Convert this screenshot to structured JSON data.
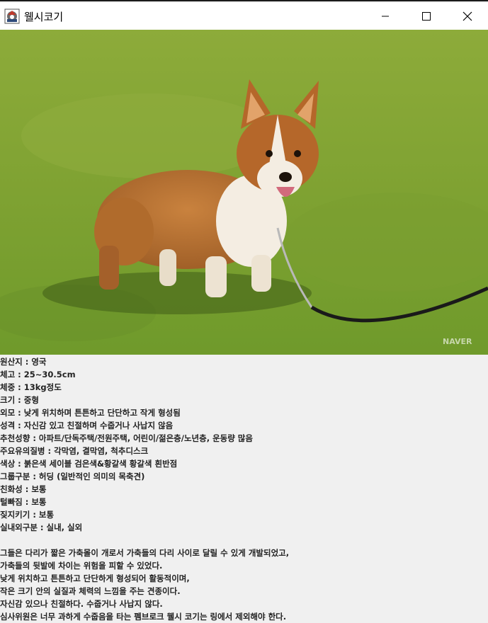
{
  "window": {
    "title": "웰시코기",
    "icon": "app-window-icon",
    "controls": [
      "minimize-icon",
      "maximize-icon",
      "close-icon"
    ]
  },
  "photo": {
    "subject": "corgi-photo",
    "watermark": "NAVER"
  },
  "attributes": [
    "원산지 : 영국",
    "체고 : 25~30.5cm",
    "체중 : 13kg정도",
    "크기 : 중형",
    "외모 : 낮게 위치하며 튼튼하고 단단하고 작게 형성됨",
    "성격 : 자신감 있고 친절하며 수줍거나 사납지 않음",
    "추천성향 : 아파트/단독주택/전원주택, 어린이/젊은층/노년층, 운동량 많음",
    "주요유의질병 : 각막염, 결막염, 척추디스크",
    "색상 : 붉은색 세이블 검은색&황갈색 황갈색 흰반점",
    "그룹구분 : 허딩 (일반적인 의미의 목축견)",
    "친화성 : 보통",
    "털빠짐 : 보통",
    "짖지키기 : 보통",
    "실내외구분 : 실내, 실외"
  ],
  "description": [
    "그들은 다리가 짧은 가축몰이 개로서 가축들의 다리 사이로 달릴 수 있게 개발되었고,",
    "가축들의 뒷발에 차이는 위험을 피할 수 있었다.",
    "낮게 위치하고 튼튼하고 단단하게 형성되어 활동적이며,",
    "작은 크기 안의 실질과 체력의 느낌을 주는 견종이다.",
    "자신감 있으나 친절하다. 수줍거나 사납지 않다.",
    "심사위원은 너무 과하게 수줍음을 타는 펨브로크 웰시 코기는 링에서 제외해야 한다."
  ]
}
